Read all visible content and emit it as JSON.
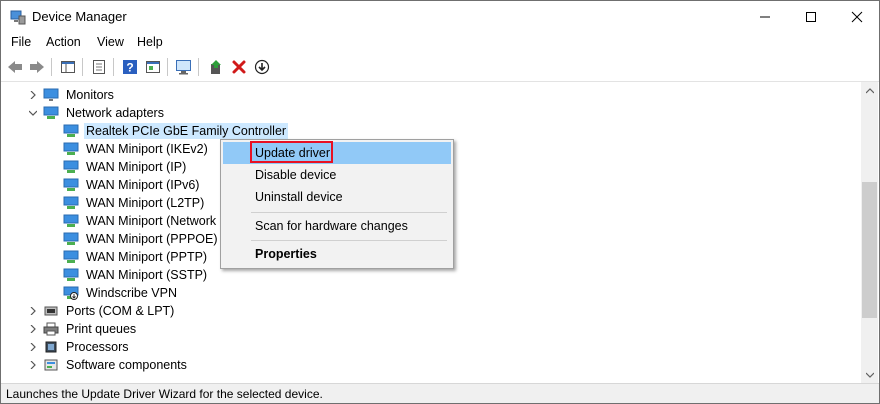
{
  "window": {
    "title": "Device Manager",
    "controls": [
      "minimize",
      "maximize",
      "close"
    ]
  },
  "menubar": {
    "items": [
      "File",
      "Action",
      "View",
      "Help"
    ]
  },
  "toolbar": {
    "buttons": [
      "back-arrow-icon",
      "forward-arrow-icon",
      "show-hide-tree-icon",
      "properties-icon",
      "help-icon",
      "view-icon",
      "scan-computer-icon",
      "update-driver-icon",
      "uninstall-icon",
      "download-icon"
    ]
  },
  "tree": {
    "rows": [
      {
        "label": "Monitors",
        "expander": "collapsed",
        "level": 1
      },
      {
        "label": "Network adapters",
        "expander": "expanded",
        "level": 1
      },
      {
        "label": "Realtek PCIe GbE Family Controller",
        "level": 2,
        "selected": true
      },
      {
        "label": "WAN Miniport (IKEv2)",
        "level": 2
      },
      {
        "label": "WAN Miniport (IP)",
        "level": 2
      },
      {
        "label": "WAN Miniport (IPv6)",
        "level": 2
      },
      {
        "label": "WAN Miniport (L2TP)",
        "level": 2
      },
      {
        "label": "WAN Miniport (Network I",
        "level": 2
      },
      {
        "label": "WAN Miniport (PPPOE)",
        "level": 2
      },
      {
        "label": "WAN Miniport (PPTP)",
        "level": 2
      },
      {
        "label": "WAN Miniport (SSTP)",
        "level": 2
      },
      {
        "label": "Windscribe VPN",
        "level": 2
      },
      {
        "label": "Ports (COM & LPT)",
        "expander": "collapsed",
        "level": 1
      },
      {
        "label": "Print queues",
        "expander": "collapsed",
        "level": 1
      },
      {
        "label": "Processors",
        "expander": "collapsed",
        "level": 1
      },
      {
        "label": "Software components",
        "expander": "collapsed",
        "level": 1
      }
    ]
  },
  "context_menu": {
    "items": [
      {
        "label": "Update driver",
        "highlighted": true
      },
      {
        "label": "Disable device"
      },
      {
        "label": "Uninstall device"
      },
      {
        "label": "Scan for hardware changes"
      },
      {
        "label": "Properties",
        "bold": true
      }
    ]
  },
  "statusbar": {
    "text": "Launches the Update Driver Wizard for the selected device."
  },
  "colors": {
    "selection": "#cce8ff",
    "menu_highlight": "#91c9f7",
    "highlight_box": "#e81123",
    "network_icon": "#1e88e5"
  }
}
